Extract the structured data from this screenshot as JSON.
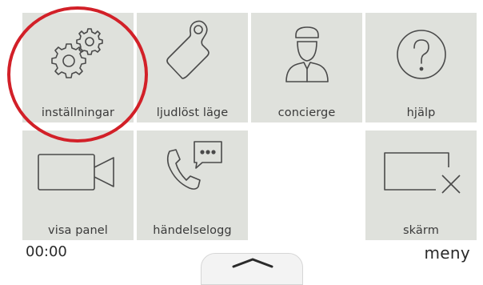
{
  "tiles": [
    {
      "label": "inställningar",
      "icon": "settings-gears-icon"
    },
    {
      "label": "ljudlöst läge",
      "icon": "do-not-disturb-hanger-icon"
    },
    {
      "label": "concierge",
      "icon": "concierge-person-icon"
    },
    {
      "label": "hjälp",
      "icon": "help-question-icon"
    },
    {
      "label": "visa panel",
      "icon": "video-camera-icon"
    },
    {
      "label": "händelselogg",
      "icon": "call-log-icon"
    },
    {
      "label": "",
      "icon": ""
    },
    {
      "label": "skärm",
      "icon": "screen-off-icon"
    }
  ],
  "footer": {
    "time": "00:00",
    "menu_label": "meny"
  },
  "colors": {
    "tile_bg": "#dfe1dc",
    "highlight": "#d22028",
    "icon_stroke": "#4a4a4a"
  }
}
